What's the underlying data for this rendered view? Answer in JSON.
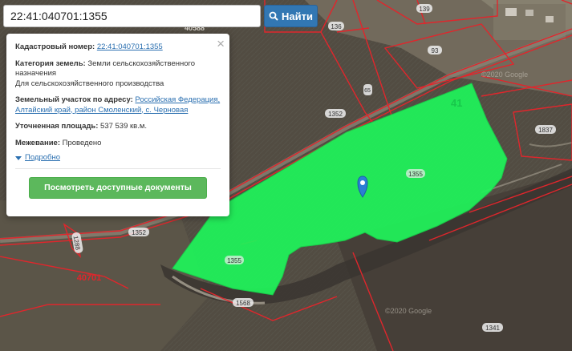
{
  "search": {
    "value": "22:41:040701:1355",
    "button_label": "Найти"
  },
  "popup": {
    "cadastral_label": "Кадастровый номер:",
    "cadastral_value": "22:41:040701:1355",
    "category_label": "Категория земель:",
    "category_value": "Земли сельскохозяйственного назначения",
    "category_use": "Для сельскохозяйственного производства",
    "address_label": "Земельный участок по адресу:",
    "address_value": "Российская Федерация, Алтайский край, район Смоленский, с. Черновая",
    "area_label": "Уточненная площадь:",
    "area_value": "537 539 кв.м.",
    "survey_label": "Межевание:",
    "survey_value": "Проведено",
    "more_label": "Подробно",
    "docs_button": "Посмотреть доступные документы",
    "close_glyph": "×"
  },
  "map_labels": {
    "parcel_139": "139",
    "parcel_136": "136",
    "parcel_93": "93",
    "parcel_41": "41",
    "parcel_1352_a": "1352",
    "parcel_1352_b": "1352",
    "parcel_1355_a": "1355",
    "parcel_1355_b": "1355",
    "parcel_1837": "1837",
    "parcel_1568": "1568",
    "parcel_1341": "1341",
    "parcel_1288": "1288",
    "parcel_65": "65",
    "quarter_40701": "40701",
    "partial_top": "40588",
    "watermark_1": "©2020 Google",
    "watermark_2": "©2020 Google"
  },
  "colors": {
    "highlight": "#1ff55a",
    "boundary": "#e0262c",
    "search_button": "#3277b3",
    "docs_button": "#5cb85c",
    "marker": "#2b7fd4"
  }
}
